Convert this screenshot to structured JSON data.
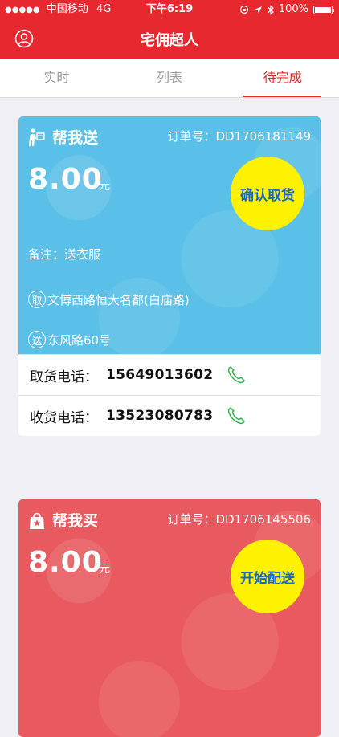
{
  "status_bar": {
    "carrier": "中国移动",
    "network": "4G",
    "time": "下午6:19",
    "battery": "100%",
    "signal_dots": "●●●●●"
  },
  "nav": {
    "title": "宅佣超人",
    "profile_icon": "user-circle-icon"
  },
  "tabs": [
    {
      "label": "实时",
      "active": false
    },
    {
      "label": "列表",
      "active": false
    },
    {
      "label": "待完成",
      "active": true
    }
  ],
  "orders": [
    {
      "type_label": "帮我送",
      "type_icon": "delivery-person-icon",
      "order_no": "订单号：DD1706181149",
      "price": "8.00",
      "unit": "元",
      "action_label": "确认取货",
      "note": "备注：送衣服",
      "pickup_tag": "取",
      "pickup_address": "文博西路恒大名都(白庙路)",
      "dropoff_tag": "送",
      "dropoff_address": "东风路60号",
      "pickup_phone_label": "取货电话：",
      "pickup_phone": "15649013602",
      "receive_phone_label": "收货电话：",
      "receive_phone": "13523080783",
      "color": "#5bc0e8"
    },
    {
      "type_label": "帮我买",
      "type_icon": "shopping-bag-icon",
      "order_no": "订单号：DD1706145506",
      "price": "8.00",
      "unit": "元",
      "action_label": "开始配送",
      "color": "#e85a5f"
    }
  ],
  "colors": {
    "brand": "#e8282f",
    "phone_icon": "#2db84b",
    "action_circle": "#fff200"
  }
}
